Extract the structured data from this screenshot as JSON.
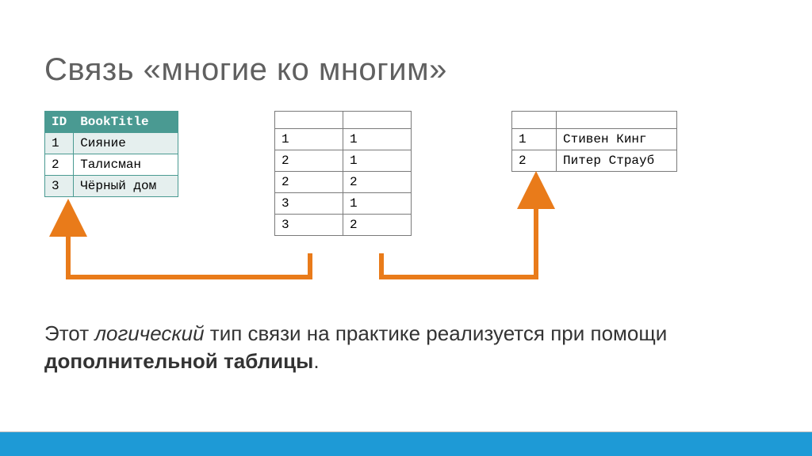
{
  "title": "Связь «многие ко многим»",
  "tables": {
    "books": {
      "headers": [
        "ID",
        "BookTitle"
      ],
      "rows": [
        [
          "1",
          "Сияние"
        ],
        [
          "2",
          "Талисман"
        ],
        [
          "3",
          "Чёрный дом"
        ]
      ]
    },
    "junction": {
      "headers": [
        "",
        ""
      ],
      "rows": [
        [
          "1",
          "1"
        ],
        [
          "2",
          "1"
        ],
        [
          "2",
          "2"
        ],
        [
          "3",
          "1"
        ],
        [
          "3",
          "2"
        ]
      ]
    },
    "authors": {
      "headers": [
        "",
        ""
      ],
      "rows": [
        [
          "1",
          "Стивен Кинг"
        ],
        [
          "2",
          "Питер Страуб"
        ]
      ]
    }
  },
  "caption": {
    "pre": "Этот ",
    "italic": "логический",
    "mid": " тип связи на практике реализуется при помощи ",
    "bold": "дополнительной таблицы",
    "post": "."
  },
  "colors": {
    "header_bg": "#4a9a92",
    "arrow": "#e97b1a",
    "footer": "#1e9ad6"
  }
}
